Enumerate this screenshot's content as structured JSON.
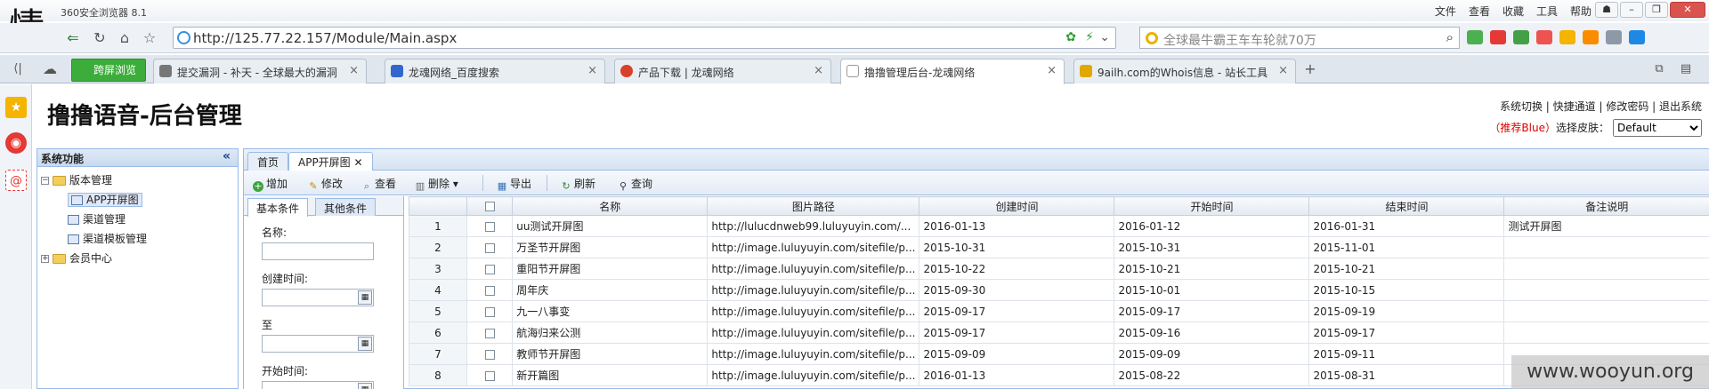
{
  "browser": {
    "logo_char": "情",
    "app_name": "360安全浏览器 8.1",
    "menu": [
      "文件",
      "查看",
      "收藏",
      "工具",
      "帮助"
    ],
    "window_controls": [
      "☗",
      "–",
      "❐",
      "✕"
    ],
    "url": "http://125.77.22.157/Module/Main.aspx",
    "search_placeholder": "全球最牛霸王车车轮就70万",
    "tabs": [
      {
        "label": "提交漏洞 - 补天 - 全球最大的漏洞响应",
        "close": "×",
        "color": "#555"
      },
      {
        "label": "龙魂网络_百度搜索",
        "close": "×",
        "color": "#3366cc"
      },
      {
        "label": "产品下载 | 龙魂网络",
        "close": "×",
        "color": "#d9402b"
      },
      {
        "label": "撸撸管理后台-龙魂网络",
        "close": "×",
        "color": "#ffffff"
      },
      {
        "label": "9ailh.com的Whois信息 - 站长工具",
        "close": "×",
        "color": "#e0a800"
      }
    ],
    "new_tab": "+",
    "cross_screen_label": "跨屏浏览"
  },
  "app": {
    "title": "撸撸语音-后台管理",
    "top_links": "系统切换 | 快捷通道 | 修改密码 | 退出系统",
    "skin_tip": "（推荐Blue）",
    "skin_label": "选择皮肤：",
    "skin_value": "Default"
  },
  "sidebar": {
    "title": "系统功能",
    "collapse_icon": "«",
    "nodes": [
      {
        "label": "版本管理",
        "expander": "−"
      },
      {
        "label": "APP开屏图"
      },
      {
        "label": "渠道管理"
      },
      {
        "label": "渠道模板管理"
      },
      {
        "label": "会员中心",
        "expander": "+"
      }
    ]
  },
  "main": {
    "tabs": [
      {
        "label": "首页"
      },
      {
        "label": "APP开屏图 ✕"
      }
    ],
    "toolbar": {
      "add": "增加",
      "edit": "修改",
      "view": "查看",
      "delete": "删除",
      "export": "导出",
      "refresh": "刷新",
      "query": "查询"
    },
    "query": {
      "tab_basic": "基本条件",
      "tab_other": "其他条件",
      "name_label": "名称:",
      "created_label": "创建时间:",
      "to_label": "至",
      "start_label": "开始时间:"
    },
    "table": {
      "columns": [
        "",
        "",
        "名称",
        "图片路径",
        "创建时间",
        "开始时间",
        "结束时间",
        "备注说明"
      ],
      "rows": [
        [
          "1",
          "uu测试开屏图",
          "http://lulucdnweb99.luluyuyin.com/...",
          "2016-01-13",
          "2016-01-12",
          "2016-01-31",
          "测试开屏图"
        ],
        [
          "2",
          "万圣节开屏图",
          "http://image.luluyuyin.com/sitefile/p...",
          "2015-10-31",
          "2015-10-31",
          "2015-11-01",
          ""
        ],
        [
          "3",
          "重阳节开屏图",
          "http://image.luluyuyin.com/sitefile/p...",
          "2015-10-22",
          "2015-10-21",
          "2015-10-21",
          ""
        ],
        [
          "4",
          "周年庆",
          "http://image.luluyuyin.com/sitefile/p...",
          "2015-09-30",
          "2015-10-01",
          "2015-10-15",
          ""
        ],
        [
          "5",
          "九一八事变",
          "http://image.luluyuyin.com/sitefile/p...",
          "2015-09-17",
          "2015-09-17",
          "2015-09-19",
          ""
        ],
        [
          "6",
          "航海归来公测",
          "http://image.luluyuyin.com/sitefile/p...",
          "2015-09-17",
          "2015-09-16",
          "2015-09-17",
          ""
        ],
        [
          "7",
          "教师节开屏图",
          "http://image.luluyuyin.com/sitefile/p...",
          "2015-09-09",
          "2015-09-09",
          "2015-09-11",
          ""
        ],
        [
          "8",
          "新开篇图",
          "http://image.luluyuyin.com/sitefile/p...",
          "2016-01-13",
          "2015-08-22",
          "2015-08-31",
          ""
        ]
      ]
    }
  },
  "watermark": "www.wooyun.org"
}
